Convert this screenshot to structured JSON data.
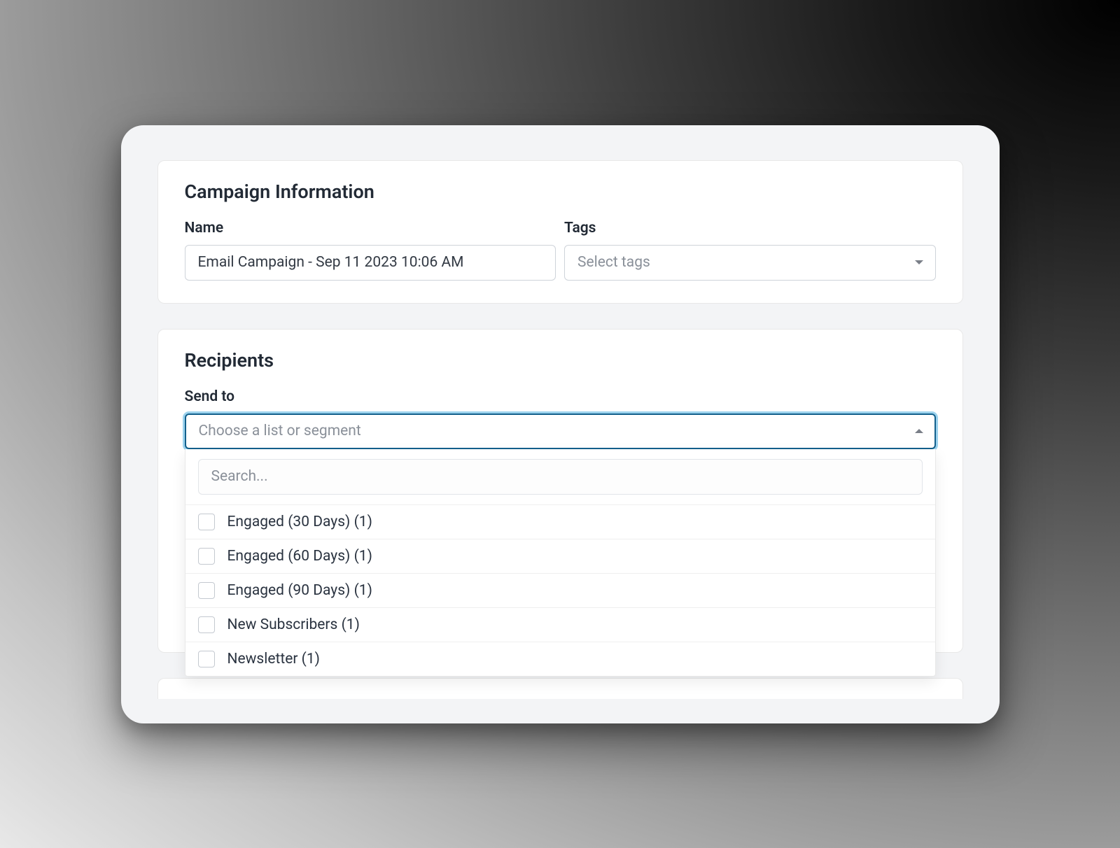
{
  "campaign_info": {
    "title": "Campaign Information",
    "name_label": "Name",
    "name_value": "Email Campaign - Sep 11 2023 10:06 AM",
    "tags_label": "Tags",
    "tags_placeholder": "Select tags"
  },
  "recipients": {
    "title": "Recipients",
    "send_to_label": "Send to",
    "send_to_placeholder": "Choose a list or segment",
    "search_placeholder": "Search...",
    "options": [
      {
        "label": "Engaged (30 Days) (1)"
      },
      {
        "label": "Engaged (60 Days) (1)"
      },
      {
        "label": "Engaged (90 Days) (1)"
      },
      {
        "label": "New Subscribers (1)"
      },
      {
        "label": "Newsletter (1)"
      }
    ]
  }
}
